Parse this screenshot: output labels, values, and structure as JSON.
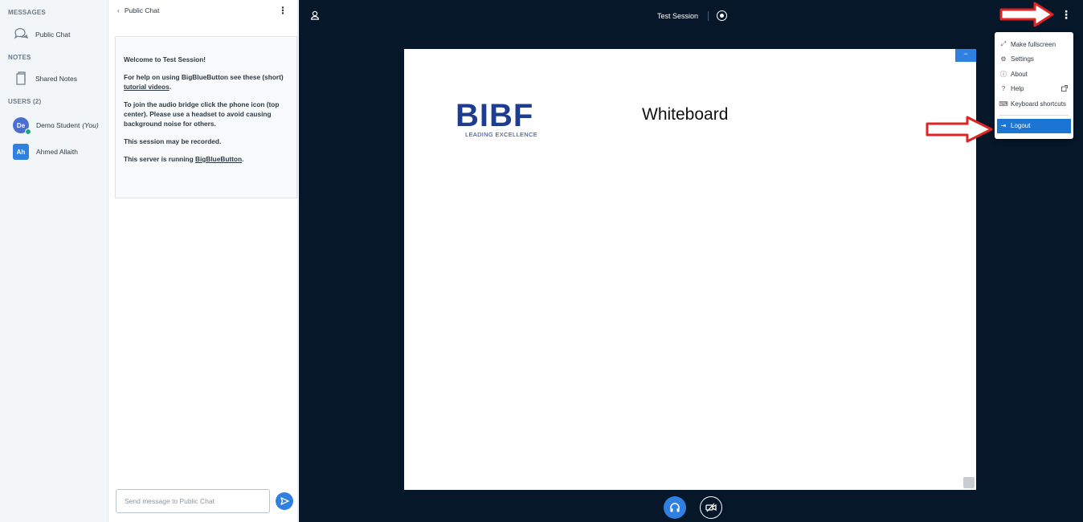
{
  "userlist": {
    "messages_title": "MESSAGES",
    "public_chat_label": "Public Chat",
    "notes_title": "NOTES",
    "shared_notes_label": "Shared Notes",
    "users_title": "USERS (2)",
    "users": [
      {
        "initials": "De",
        "name": "Demo Student",
        "suffix": "(You)",
        "color": "#4a6fd1"
      },
      {
        "initials": "Ah",
        "name": "Ahmed Allaith",
        "suffix": "",
        "color": "#2f80e0"
      }
    ]
  },
  "chat": {
    "header": "Public Chat",
    "welcome": "Welcome to Test Session!",
    "help_pre": "For help on using BigBlueButton see these (short) ",
    "help_link": "tutorial videos",
    "help_post": ".",
    "audio": "To join the audio bridge click the phone icon (top center). Please use a headset to avoid causing background noise for others.",
    "recorded": "This session may be recorded.",
    "server_pre": "This server is running ",
    "server_link": "BigBlueButton",
    "server_post": ".",
    "input_placeholder": "Send message to Public Chat"
  },
  "main": {
    "session_title": "Test Session",
    "slide": {
      "logo_text": "BIBF",
      "logo_sub": "LEADING EXCELLENCE",
      "title": "Whiteboard"
    }
  },
  "menu": {
    "items": [
      {
        "label": "Make fullscreen",
        "icon": "fullscreen-icon"
      },
      {
        "label": "Settings",
        "icon": "gear-icon"
      },
      {
        "label": "About",
        "icon": "info-icon"
      },
      {
        "label": "Help",
        "icon": "help-icon"
      },
      {
        "label": "Keyboard shortcuts",
        "icon": "keyboard-icon"
      }
    ],
    "logout_label": "Logout"
  },
  "colors": {
    "accent": "#1b75d3",
    "dark_bg": "#06172a",
    "arrow": "#e02424"
  }
}
